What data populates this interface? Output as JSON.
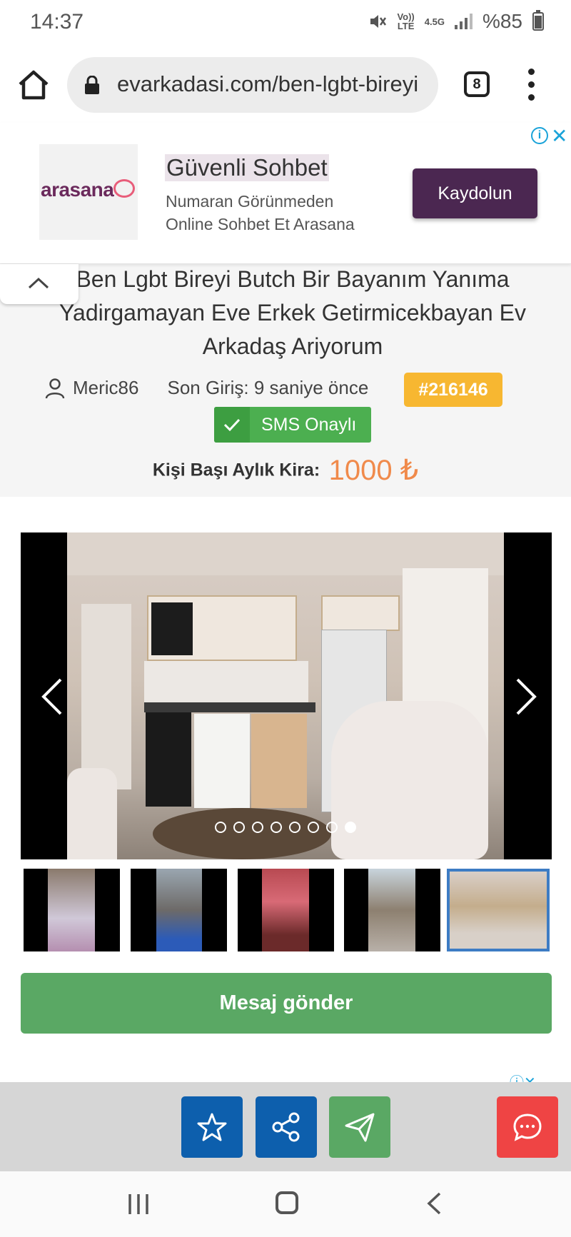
{
  "status_bar": {
    "time": "14:37",
    "network_label_top": "Vo))",
    "network_label_bottom": "LTE",
    "network_type": "4.5G",
    "battery": "%85"
  },
  "browser": {
    "url": "evarkadasi.com/ben-lgbt-bireyi",
    "tab_count": "8"
  },
  "ad": {
    "logo_text": "arasana",
    "title": "Güvenli Sohbet",
    "description_line1": "Numaran Görünmeden",
    "description_line2": "Online Sohbet Et Arasana",
    "cta_label": "Kaydolun",
    "info_icon": "i",
    "close_icon": "✕"
  },
  "listing": {
    "title": "Ben Lgbt Bireyi Butch Bir Bayanım Yanıma Yadirgamayan Eve Erkek Getirmicekbayan Ev Arkadaş Ariyorum",
    "username": "Meric86",
    "last_login": "Son Giriş: 9 saniye önce",
    "id_badge": "#216146",
    "sms_badge": "SMS Onaylı",
    "rent_label": "Kişi Başı Aylık Kira:",
    "rent_value": "1000 ₺"
  },
  "gallery": {
    "photo_count": 8,
    "active_index": 7,
    "thumbnail_count": 5,
    "active_thumbnail": 4
  },
  "actions": {
    "message_button": "Mesaj gönder",
    "favorite_icon": "star-icon",
    "share_icon": "share-icon",
    "send_icon": "paper-plane-icon",
    "chat_icon": "chat-bubble-icon"
  },
  "colors": {
    "ad_cta": "#4b2751",
    "id_badge": "#f7b731",
    "sms_badge": "#4caf50",
    "rent_value": "#f08a4b",
    "message_button": "#5aa864",
    "blue_action": "#0d5fad",
    "red_action": "#ef4444"
  }
}
